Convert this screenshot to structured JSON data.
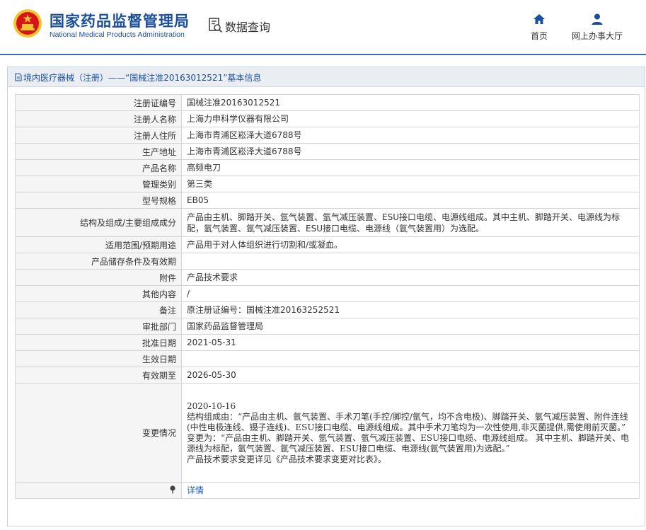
{
  "header": {
    "site_title_cn": "国家药品监督管理局",
    "site_title_en": "National Medical Products Administration",
    "data_query": "数据查询",
    "nav": {
      "home": "首页",
      "online_service": "网上办事大厅"
    }
  },
  "panel": {
    "title": "境内医疗器械（注册）——“国械注准20163012521”基本信息"
  },
  "rows": [
    {
      "key": "注册证编号",
      "value": "国械注准20163012521"
    },
    {
      "key": "注册人名称",
      "value": "上海力申科学仪器有限公司"
    },
    {
      "key": "注册人住所",
      "value": "上海市青浦区崧泽大道6788号"
    },
    {
      "key": "生产地址",
      "value": "上海市青浦区崧泽大道6788号"
    },
    {
      "key": "产品名称",
      "value": "高频电刀"
    },
    {
      "key": "管理类别",
      "value": "第三类"
    },
    {
      "key": "型号规格",
      "value": "EB05"
    },
    {
      "key": "结构及组成/主要组成成分",
      "value": "产品由主机、脚踏开关、氩气装置、氩气减压装置、ESU接口电缆、电源线组成。其中主机、脚踏开关、电源线为标配，氩气装置、氩气减压装置、ESU接口电缆、电源线（氩气装置用）为选配。"
    },
    {
      "key": "适用范围/预期用途",
      "value": "产品用于对人体组织进行切割和/或凝血。"
    },
    {
      "key": "产品储存条件及有效期",
      "value": ""
    },
    {
      "key": "附件",
      "value": "产品技术要求"
    },
    {
      "key": "其他内容",
      "value": "/"
    },
    {
      "key": "备注",
      "value": "原注册证编号：国械注准20163252521"
    },
    {
      "key": "审批部门",
      "value": "国家药品监督管理局"
    },
    {
      "key": "批准日期",
      "value": "2021-05-31"
    },
    {
      "key": "生效日期",
      "value": ""
    },
    {
      "key": "有效期至",
      "value": "2026-05-30"
    }
  ],
  "change": {
    "key": "变更情况",
    "lines": [
      "2020-10-16",
      "结构组成由：“产品由主机、氩气装置、手术刀笔(手控/脚控/氩气，均不含电极)、脚踏开关、氩气减压装置、附件连线(中性电极连线、镊子连线)、ESU接口电缆、电源线组成。其中手术刀笔均为一次性使用,非灭菌提供,需使用前灭菌。”",
      "变更为：“产品由主机、脚踏开关、氩气装置、氩气减压装置、ESU接口电缆、电源线组成。 其中主机、脚踏开关、电源线为标配，氩气装置、氩气减压装置、ESU接口电缆、电源线(氩气装置用)为选配。”",
      "产品技术要求变更详见《产品技术要求变更对比表》。"
    ]
  },
  "detail": {
    "link_text": "详情"
  },
  "colors": {
    "brand_blue": "#1b4f9c",
    "emblem_red": "#d7141a",
    "emblem_gold": "#f4c430",
    "link_blue": "#1b5fb7"
  }
}
